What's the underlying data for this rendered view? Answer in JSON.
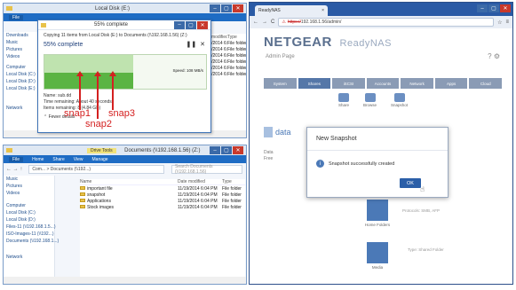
{
  "explorer_top": {
    "title": "Local Disk (E:)",
    "ribbon": [
      "File",
      "Home",
      "Share",
      "View"
    ],
    "nav": [
      "Downloads",
      "Music",
      "Pictures",
      "Videos",
      "Computer",
      "Local Disk (C:)",
      "Local Disk (D:)",
      "Local Disk (E:)"
    ],
    "col_headers": [
      "Date modified",
      "Type"
    ],
    "rows": [
      {
        "date": "11/19/2014 6:05 PM",
        "type": "File folder"
      },
      {
        "date": "11/19/2014 6:05 PM",
        "type": "File folder"
      },
      {
        "date": "11/19/2014 6:05 PM",
        "type": "File folder"
      },
      {
        "date": "11/19/2014 6:05 PM",
        "type": "File folder"
      },
      {
        "date": "11/19/2014 6:05 PM",
        "type": "File folder"
      },
      {
        "date": "11/19/2014 6:05 PM",
        "type": "File folder"
      }
    ],
    "nav_bottom": "Network"
  },
  "copy_dialog": {
    "title": "55% complete",
    "line1": "Copying 11 items from Local Disk (E:) to Documents (\\\\192.168.1.56) (Z:)",
    "progress_label": "55% complete",
    "progress": 0.55,
    "speed": "Speed: 108 MB/s",
    "name": "Name: sub.dd",
    "time_remaining": "Time remaining: About 40 seconds",
    "items_remaining": "Items remaining: 8 (4.84 GB)",
    "fewer_details": "Fewer details"
  },
  "annotations": {
    "snap1": "snap1",
    "snap2": "snap2",
    "snap3": "snap3"
  },
  "explorer_bottom": {
    "title": "Documents (\\\\192.168.1.56) (Z:)",
    "drive_tools": "Drive Tools",
    "ribbon": [
      "File",
      "Home",
      "Share",
      "View",
      "Manage"
    ],
    "address": "Com... > Documents (\\\\192...)",
    "search_placeholder": "Search Documents (\\\\192.168.1.56)",
    "col_name": "Name",
    "col_date": "Date modified",
    "col_type": "Type",
    "nav": [
      "Music",
      "Pictures",
      "Videos",
      "Computer",
      "Local Disk (C:)",
      "Local Disk (D:)",
      "Files-11 (\\\\192.168.1.5...)",
      "ISO-Images-11 (\\\\192...)",
      "Documents (\\\\192.168.1...)"
    ],
    "files": [
      {
        "name": "important file",
        "date": "11/19/2014 6:04 PM",
        "type": "File folder"
      },
      {
        "name": "snapshot",
        "date": "11/19/2014 6:04 PM",
        "type": "File folder"
      },
      {
        "name": "Applications",
        "date": "11/19/2014 6:04 PM",
        "type": "File folder"
      },
      {
        "name": "Stock images",
        "date": "11/19/2014 6:04 PM",
        "type": "File folder"
      }
    ],
    "nav_bottom": "Network"
  },
  "browser": {
    "tab_title": "ReadyNAS",
    "url_prefix": "https://",
    "url": "192.168.1.56/admin/",
    "logo": "NETGEAR",
    "logo_suffix": "ReadyNAS",
    "subtitle": "Admin Page",
    "nav_tabs": [
      "System",
      "Shares",
      "iSCSI",
      "Accounts",
      "Network",
      "Apps",
      "Cloud"
    ],
    "toolbar": [
      "Share",
      "Browse",
      "Snapshot"
    ],
    "left_item": "data",
    "left_sub": [
      "Data",
      "Free"
    ],
    "right_info_a": "Protocols: SMB, AFP",
    "right_info_b": "Type: Shared Folder",
    "btn_home_folders": "Home Folders",
    "btn_media": "Media",
    "modal_title": "New Snapshot",
    "modal_message": "Snapshot successfully created",
    "modal_ok": "OK"
  },
  "colors": {
    "progress_fill": "#5bb443",
    "win_border": "#7a9cc8",
    "arrow_red": "#d42020",
    "netgear_blue": "#4b79b7",
    "modal_btn": "#2b5fa8"
  }
}
